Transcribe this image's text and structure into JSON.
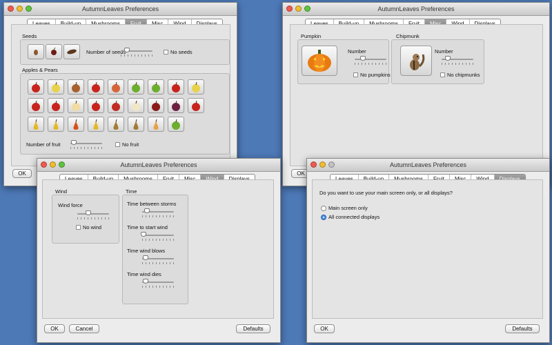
{
  "window_title": "AutumnLeaves Preferences",
  "tabs": [
    "Leaves",
    "Build-up",
    "Mushrooms",
    "Fruit",
    "Misc",
    "Wind",
    "Displays"
  ],
  "fruit_window": {
    "selected_tab": "Fruit",
    "seeds": {
      "title": "Seeds",
      "tiles": [
        "seed-icon",
        "cherry-seed-icon",
        "pod-icon"
      ],
      "number_label": "Number of seeds",
      "number_level": 0.2,
      "none_label": "No seeds"
    },
    "apples_pears": {
      "title": "Apples & Pears",
      "rows": [
        [
          "red-apple-icon",
          "yellow-apple-icon",
          "russet-apple-icon",
          "red-apple-icon",
          "blush-apple-icon",
          "green-apple-icon",
          "green-apple-icon",
          "red-apple-icon",
          "yellow-apple-icon"
        ],
        [
          "red-apple-icon",
          "red-apple-icon",
          "pale-apple-icon",
          "red-apple-icon",
          "bitten-apple-icon",
          "apple-core-icon",
          "dark-apple-icon",
          "purple-apple-icon",
          "red-apple-icon"
        ],
        [
          "yellow-pear-icon",
          "yellow-pear-icon",
          "red-pear-icon",
          "yellow-pear-icon",
          "brown-pear-icon",
          "brown-pear-icon",
          "orange-pear-icon",
          "green-apple-icon"
        ]
      ],
      "number_label": "Number of fruit",
      "number_level": 0.1,
      "none_label": "No fruit"
    },
    "ok_label": "OK"
  },
  "misc_window": {
    "selected_tab": "Misc",
    "pumpkin": {
      "title": "Pumpkin",
      "icon": "pumpkin-icon",
      "number_label": "Number",
      "number_level": 0.25,
      "none_label": "No pumpkins"
    },
    "chipmunk": {
      "title": "Chipmunk",
      "icon": "chipmunk-icon",
      "number_label": "Number",
      "number_level": 0.2,
      "none_label": "No chipmunks"
    },
    "ok_label": "OK"
  },
  "wind_window": {
    "selected_tab": "Wind",
    "wind_group": {
      "title": "Wind",
      "force_label": "Wind force",
      "force_level": 0.35,
      "none_label": "No wind"
    },
    "time_group": {
      "title": "Time",
      "sliders": [
        {
          "label": "Time between storms",
          "level": 0.15
        },
        {
          "label": "Time to start wind",
          "level": 0.05
        },
        {
          "label": "Time wind blows",
          "level": 0.1
        },
        {
          "label": "Time wind dies",
          "level": 0.1
        }
      ]
    },
    "buttons": {
      "ok": "OK",
      "cancel": "Cancel",
      "defaults": "Defaults"
    }
  },
  "displays_window": {
    "selected_tab": "Displays",
    "question": "Do you want to use your main screen only, or all displays?",
    "options": [
      {
        "label": "Main screen only",
        "selected": false
      },
      {
        "label": "All connected displays",
        "selected": true
      }
    ],
    "buttons": {
      "ok": "OK",
      "defaults": "Defaults"
    }
  }
}
